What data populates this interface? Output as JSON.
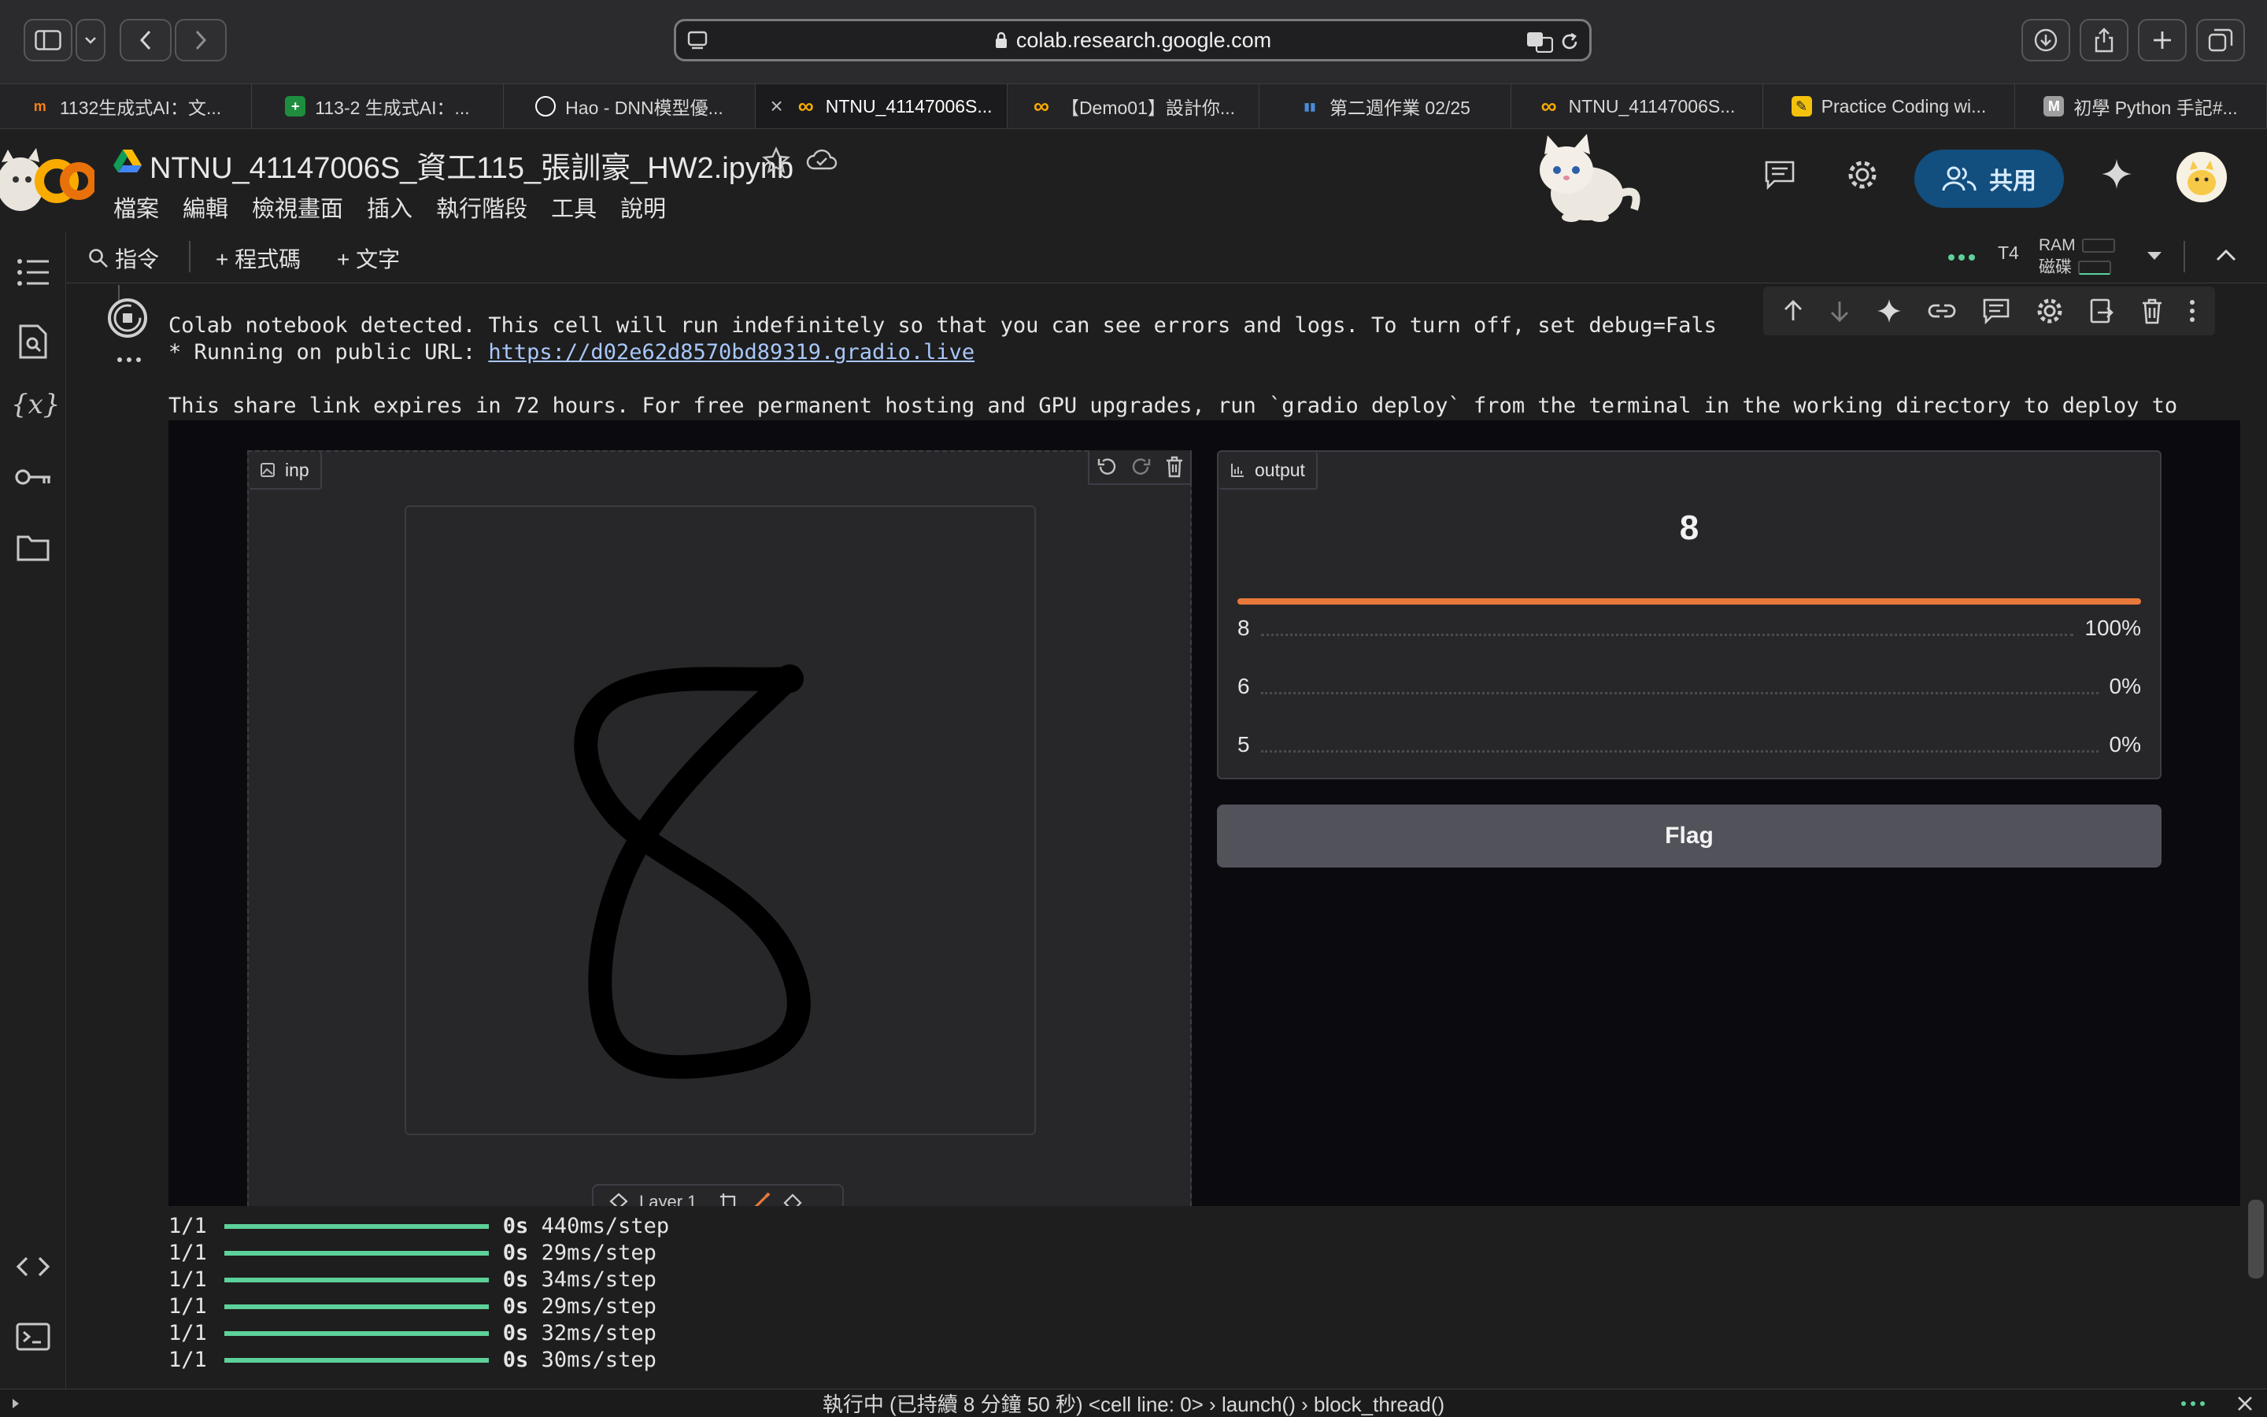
{
  "browser": {
    "url": "colab.research.google.com",
    "tabs": [
      {
        "label": "1132生成式AI：文...",
        "icon": "moodle-icon",
        "color": "#f98012"
      },
      {
        "label": "113-2 生成式AI：...",
        "icon": "sheets-icon",
        "color": "#1e8e3e"
      },
      {
        "label": "Hao - DNN模型優...",
        "icon": "openai-icon",
        "color": "#ffffff"
      },
      {
        "label": "NTNU_41147006S...",
        "icon": "colab-icon",
        "color": "#f9ab00",
        "active": true
      },
      {
        "label": "【Demo01】設計你...",
        "icon": "colab-icon",
        "color": "#f9ab00"
      },
      {
        "label": "第二週作業 02/25",
        "icon": "chart-icon",
        "color": "#4a8bd6"
      },
      {
        "label": "NTNU_41147006S...",
        "icon": "colab-icon",
        "color": "#f9ab00"
      },
      {
        "label": "Practice Coding wi...",
        "icon": "pencil-icon",
        "color": "#f4c20d"
      },
      {
        "label": "初學 Python 手記#...",
        "icon": "medium-icon",
        "color": "#9e9e9e"
      }
    ]
  },
  "colab": {
    "notebook_title": "NTNU_41147006S_資工115_張訓豪_HW2.ipynb",
    "menu": [
      "檔案",
      "編輯",
      "檢視畫面",
      "插入",
      "執行階段",
      "工具",
      "說明"
    ],
    "share_label": "共用",
    "toolbar": {
      "command_label": "指令",
      "add_code_label": "+ 程式碼",
      "add_text_label": "+ 文字",
      "runtime_label": "T4",
      "ram_label": "RAM",
      "disk_label": "磁碟"
    }
  },
  "output": {
    "line1": "Colab notebook detected. This cell will run indefinitely so that you can see errors and logs. To turn off, set debug=Fals",
    "line2_prefix": "* Running on public URL: ",
    "public_url": "https://d02e62d8570bd89319.gradio.live",
    "line3": "This share link expires in 72 hours. For free permanent hosting and GPU upgrades, run `gradio deploy` from the terminal in the working directory to deploy to"
  },
  "gradio": {
    "input_label": "inp",
    "layer_label": "Layer 1",
    "output_label": "output",
    "predicted_label": "8",
    "confidences": [
      {
        "label": "8",
        "percent": "100%",
        "value": 1.0
      },
      {
        "label": "6",
        "percent": "0%",
        "value": 0.0
      },
      {
        "label": "5",
        "percent": "0%",
        "value": 0.0
      }
    ],
    "flag_label": "Flag",
    "top_confidence_fraction": 1.0
  },
  "logs": [
    {
      "step": "1/1",
      "time": "0s",
      "rate": "440ms/step"
    },
    {
      "step": "1/1",
      "time": "0s",
      "rate": "29ms/step"
    },
    {
      "step": "1/1",
      "time": "0s",
      "rate": "34ms/step"
    },
    {
      "step": "1/1",
      "time": "0s",
      "rate": "29ms/step"
    },
    {
      "step": "1/1",
      "time": "0s",
      "rate": "32ms/step"
    },
    {
      "step": "1/1",
      "time": "0s",
      "rate": "30ms/step"
    }
  ],
  "status": {
    "text": "執行中 (已持續 8 分鐘 50 秒)  <cell line: 0>  ›  launch()  ›  block_thread()"
  }
}
